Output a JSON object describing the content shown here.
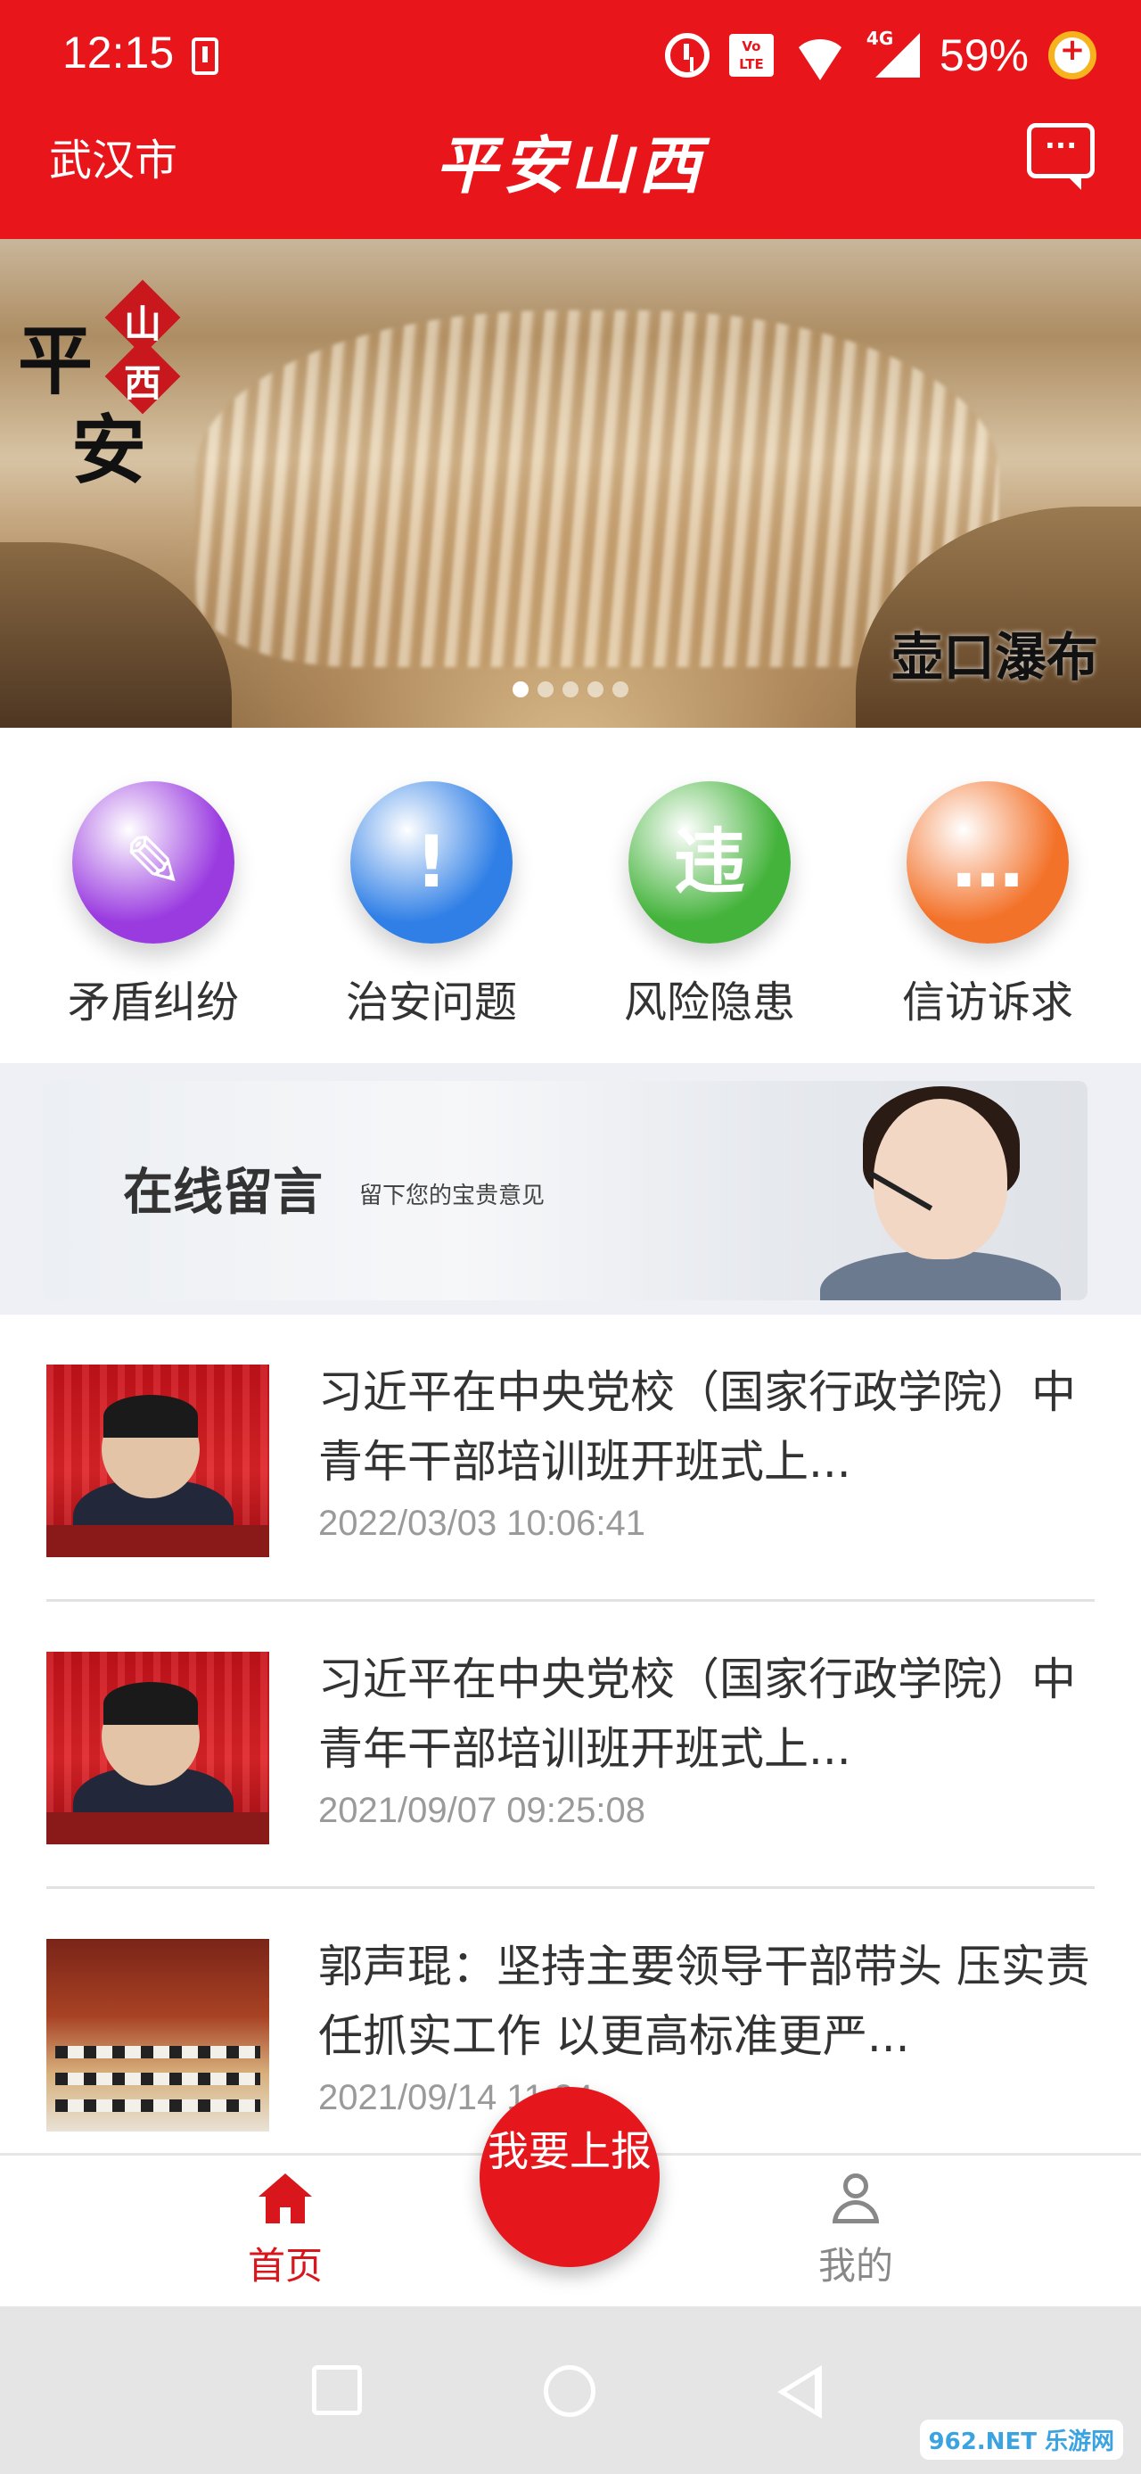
{
  "status_bar": {
    "time": "12:15",
    "volte": "Vo LTE",
    "network": "4G",
    "battery": "59%"
  },
  "header": {
    "city": "武汉市",
    "title": "平安山西"
  },
  "banner": {
    "logo_main_1": "平",
    "logo_main_2": "安",
    "logo_badge_1": "山",
    "logo_badge_2": "西",
    "caption": "壶口瀑布",
    "slides_total": 5,
    "active_slide_index": 0
  },
  "quick_actions": [
    {
      "label": "矛盾纠纷",
      "icon": "document-gavel-icon",
      "color": "#9a3be0",
      "glyph": "✎"
    },
    {
      "label": "治安问题",
      "icon": "alert-orbit-icon",
      "color": "#2f7fe6",
      "glyph": "!"
    },
    {
      "label": "风险隐患",
      "icon": "risk-search-icon",
      "color": "#44b33b",
      "glyph": "违"
    },
    {
      "label": "信访诉求",
      "icon": "chat-bubbles-icon",
      "color": "#f3722a",
      "glyph": "…"
    }
  ],
  "online_message": {
    "title": "在线留言",
    "subtitle": "留下您的宝贵意见"
  },
  "news": [
    {
      "title": "习近平在中央党校（国家行政学院）中青年干部培训班开班式上...",
      "date": "2022/03/03 10:06:41"
    },
    {
      "title": "习近平在中央党校（国家行政学院）中青年干部培训班开班式上...",
      "date": "2021/09/07 09:25:08"
    },
    {
      "title": "郭声琨：坚持主要领导干部带头 压实责任抓实工作 以更高标准更严...",
      "date": "2021/09/14 11:24"
    }
  ],
  "bottom_nav": {
    "home": "首页",
    "report": "我要上报",
    "me": "我的"
  },
  "watermark": "962.NET 乐游网"
}
